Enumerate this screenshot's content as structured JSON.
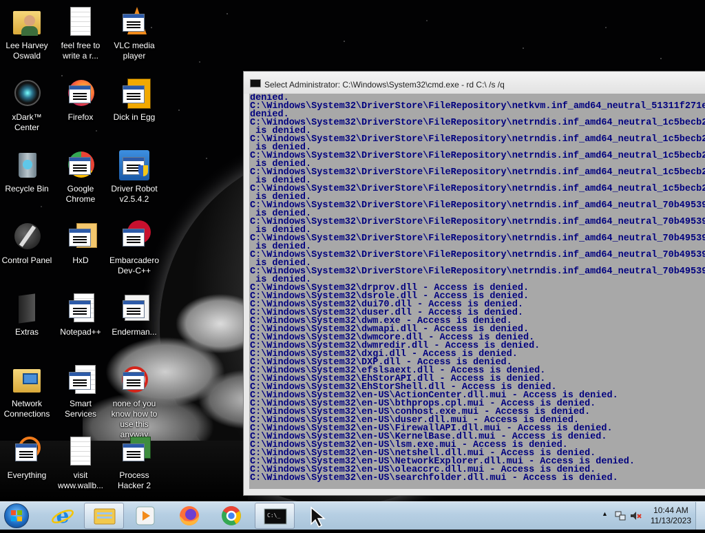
{
  "desktop": {
    "icons": [
      {
        "label": "Lee Harvey Oswald",
        "icon": "user-folder-icon"
      },
      {
        "label": "feel free to write a r...",
        "icon": "text-document-icon"
      },
      {
        "label": "VLC media player",
        "icon": "vlc-icon"
      },
      {
        "label": "xDark™ Center",
        "icon": "xdark-icon"
      },
      {
        "label": "Firefox",
        "icon": "firefox-icon"
      },
      {
        "label": "Dick in Egg",
        "icon": "app-window-icon"
      },
      {
        "label": "Recycle Bin",
        "icon": "recycle-bin-icon"
      },
      {
        "label": "Google Chrome",
        "icon": "chrome-icon"
      },
      {
        "label": "Driver Robot v2.5.4.2",
        "icon": "app-window-icon"
      },
      {
        "label": "Control Panel",
        "icon": "control-panel-icon"
      },
      {
        "label": "HxD",
        "icon": "app-window-icon"
      },
      {
        "label": "Embarcadero Dev-C++",
        "icon": "devcpp-icon"
      },
      {
        "label": "Extras",
        "icon": "folder-icon"
      },
      {
        "label": "Notepad++",
        "icon": "app-window-icon"
      },
      {
        "label": "Enderman...",
        "icon": "app-window-icon"
      },
      {
        "label": "Network Connections",
        "icon": "network-folder-icon"
      },
      {
        "label": "Smart Services",
        "icon": "app-window-icon"
      },
      {
        "label": "none of you know how to use this anyway",
        "icon": "app-window-icon"
      },
      {
        "label": "Everything",
        "icon": "app-window-icon"
      },
      {
        "label": "visit www.wallb...",
        "icon": "text-document-icon"
      },
      {
        "label": "Process Hacker 2",
        "icon": "app-window-icon"
      }
    ]
  },
  "cmd": {
    "title": "Select Administrator: C:\\Windows\\System32\\cmd.exe - rd  C:\\ /s /q",
    "lines": [
      "denied.",
      "C:\\Windows\\System32\\DriverStore\\FileRepository\\netkvm.inf_amd64_neutral_51311f271e1",
      "denied.",
      "C:\\Windows\\System32\\DriverStore\\FileRepository\\netrndis.inf_amd64_neutral_1c5becb2d",
      " is denied.",
      "C:\\Windows\\System32\\DriverStore\\FileRepository\\netrndis.inf_amd64_neutral_1c5becb2d",
      " is denied.",
      "C:\\Windows\\System32\\DriverStore\\FileRepository\\netrndis.inf_amd64_neutral_1c5becb2d",
      " is denied.",
      "C:\\Windows\\System32\\DriverStore\\FileRepository\\netrndis.inf_amd64_neutral_1c5becb2d",
      " is denied.",
      "C:\\Windows\\System32\\DriverStore\\FileRepository\\netrndis.inf_amd64_neutral_1c5becb2d",
      " is denied.",
      "C:\\Windows\\System32\\DriverStore\\FileRepository\\netrndis.inf_amd64_neutral_70b495394",
      " is denied.",
      "C:\\Windows\\System32\\DriverStore\\FileRepository\\netrndis.inf_amd64_neutral_70b495394",
      " is denied.",
      "C:\\Windows\\System32\\DriverStore\\FileRepository\\netrndis.inf_amd64_neutral_70b495394",
      " is denied.",
      "C:\\Windows\\System32\\DriverStore\\FileRepository\\netrndis.inf_amd64_neutral_70b495394",
      " is denied.",
      "C:\\Windows\\System32\\DriverStore\\FileRepository\\netrndis.inf_amd64_neutral_70b495394",
      " is denied.",
      "C:\\Windows\\System32\\drprov.dll - Access is denied.",
      "C:\\Windows\\System32\\dsrole.dll - Access is denied.",
      "C:\\Windows\\System32\\dui70.dll - Access is denied.",
      "C:\\Windows\\System32\\duser.dll - Access is denied.",
      "C:\\Windows\\System32\\dwm.exe - Access is denied.",
      "C:\\Windows\\System32\\dwmapi.dll - Access is denied.",
      "C:\\Windows\\System32\\dwmcore.dll - Access is denied.",
      "C:\\Windows\\System32\\dwmredir.dll - Access is denied.",
      "C:\\Windows\\System32\\dxgi.dll - Access is denied.",
      "C:\\Windows\\System32\\DXP.dll - Access is denied.",
      "C:\\Windows\\System32\\efslsaext.dll - Access is denied.",
      "C:\\Windows\\System32\\EhStorAPI.dll - Access is denied.",
      "C:\\Windows\\System32\\EhStorShell.dll - Access is denied.",
      "C:\\Windows\\System32\\en-US\\ActionCenter.dll.mui - Access is denied.",
      "C:\\Windows\\System32\\en-US\\bthprops.cpl.mui - Access is denied.",
      "C:\\Windows\\System32\\en-US\\conhost.exe.mui - Access is denied.",
      "C:\\Windows\\System32\\en-US\\duser.dll.mui - Access is denied.",
      "C:\\Windows\\System32\\en-US\\FirewallAPI.dll.mui - Access is denied.",
      "C:\\Windows\\System32\\en-US\\KernelBase.dll.mui - Access is denied.",
      "C:\\Windows\\System32\\en-US\\lsm.exe.mui - Access is denied.",
      "C:\\Windows\\System32\\en-US\\netshell.dll.mui - Access is denied.",
      "C:\\Windows\\System32\\en-US\\NetworkExplorer.dll.mui - Access is denied.",
      "C:\\Windows\\System32\\en-US\\oleaccrc.dll.mui - Access is denied.",
      "C:\\Windows\\System32\\en-US\\searchfolder.dll.mui - Access is denied."
    ]
  },
  "taskbar": {
    "start_icon": "windows-start-orb-icon",
    "pinned": [
      {
        "name": "internet-explorer",
        "icon": "internet-explorer-icon"
      },
      {
        "name": "windows-explorer",
        "icon": "file-explorer-icon",
        "active": true
      },
      {
        "name": "media-player",
        "icon": "media-player-icon"
      },
      {
        "name": "firefox",
        "icon": "firefox-icon"
      },
      {
        "name": "chrome",
        "icon": "chrome-icon"
      },
      {
        "name": "cmd",
        "icon": "command-prompt-icon",
        "active": true
      }
    ],
    "clock": {
      "time": "10:44 AM",
      "date": "11/13/2023"
    },
    "cmd_glyph": "C:\\_",
    "tray_arrow": "▲"
  }
}
